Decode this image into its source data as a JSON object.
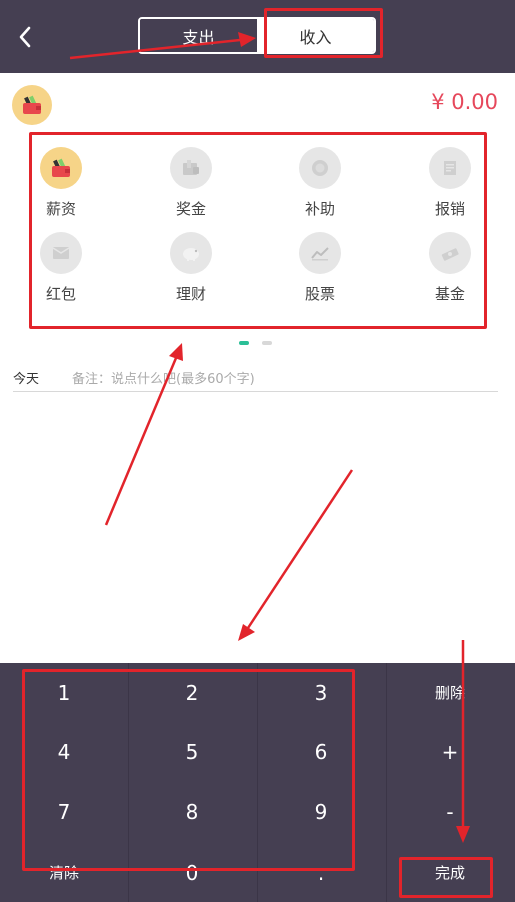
{
  "header": {
    "tabs": [
      {
        "label": "支出",
        "selected": false
      },
      {
        "label": "收入",
        "selected": true
      }
    ]
  },
  "amount": {
    "value": "¥ 0.00",
    "color": "#e6475b"
  },
  "categories": [
    {
      "label": "薪资",
      "icon": "wallet-icon",
      "selected": true
    },
    {
      "label": "奖金",
      "icon": "bonus-icon",
      "selected": false
    },
    {
      "label": "补助",
      "icon": "subsidy-icon",
      "selected": false
    },
    {
      "label": "报销",
      "icon": "reimburse-icon",
      "selected": false
    },
    {
      "label": "红包",
      "icon": "red-packet-icon",
      "selected": false
    },
    {
      "label": "理财",
      "icon": "piggy-bank-icon",
      "selected": false
    },
    {
      "label": "股票",
      "icon": "stock-chart-icon",
      "selected": false
    },
    {
      "label": "基金",
      "icon": "fund-icon",
      "selected": false
    }
  ],
  "note": {
    "date_label": "今天",
    "placeholder": "备注：说点什么吧(最多60个字)"
  },
  "keypad": {
    "keys": [
      "1",
      "2",
      "3",
      "4",
      "5",
      "6",
      "7",
      "8",
      "9",
      "清除",
      "0",
      "."
    ],
    "delete_label": "删除",
    "plus_label": "+",
    "minus_label": "-",
    "done_label": "完成"
  },
  "colors": {
    "header_bg": "#453f52",
    "accent": "#2bbf97",
    "highlight": "#f6d488",
    "annotation": "#e2242b"
  }
}
